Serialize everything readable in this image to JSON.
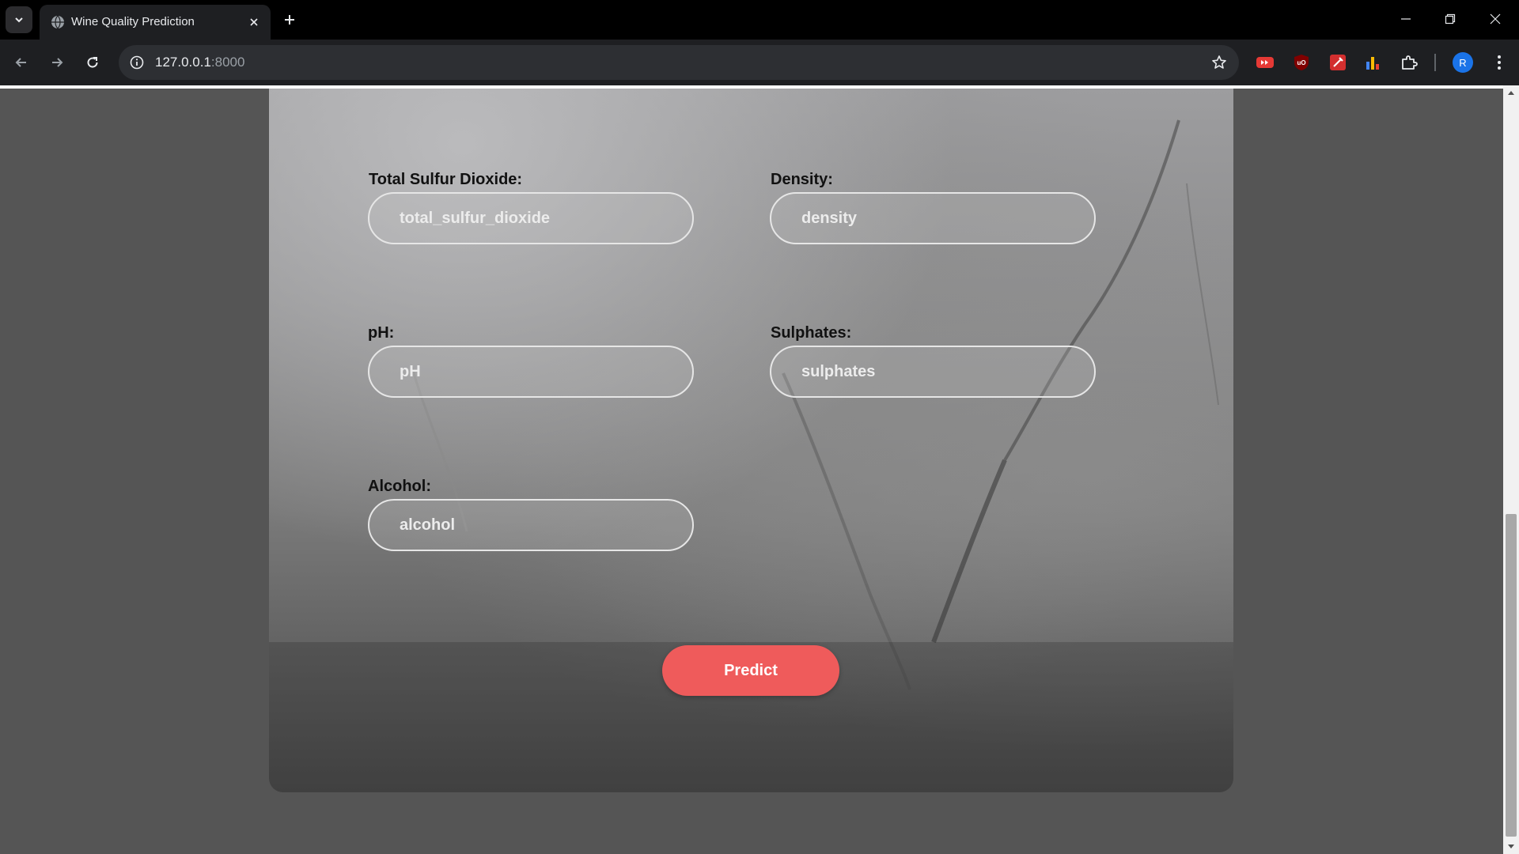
{
  "browser": {
    "tab_title": "Wine Quality Prediction",
    "url_host": "127.0.0.1",
    "url_port": ":8000",
    "profile_initial": "R",
    "icons": {
      "tab_list": "chevron-down-icon",
      "favicon": "globe-icon",
      "tab_close": "close-icon",
      "new_tab": "plus-icon",
      "back": "arrow-left-icon",
      "forward": "arrow-right-icon",
      "reload": "reload-icon",
      "site_info": "info-icon",
      "bookmark": "star-icon",
      "extensions": [
        "youtube-extension-icon",
        "ublock-extension-icon",
        "pen-extension-icon",
        "chart-extension-icon",
        "puzzle-icon"
      ],
      "menu": "kebab-menu-icon"
    }
  },
  "form": {
    "fields": [
      {
        "label": "Total Sulfur Dioxide:",
        "placeholder": "total_sulfur_dioxide"
      },
      {
        "label": "Density:",
        "placeholder": "density"
      },
      {
        "label": "pH:",
        "placeholder": "pH"
      },
      {
        "label": "Sulphates:",
        "placeholder": "sulphates"
      },
      {
        "label": "Alcohol:",
        "placeholder": "alcohol"
      }
    ],
    "submit_label": "Predict"
  },
  "colors": {
    "button": "#ef5b5b",
    "page_background": "#555555",
    "avatar": "#1a73e8"
  }
}
